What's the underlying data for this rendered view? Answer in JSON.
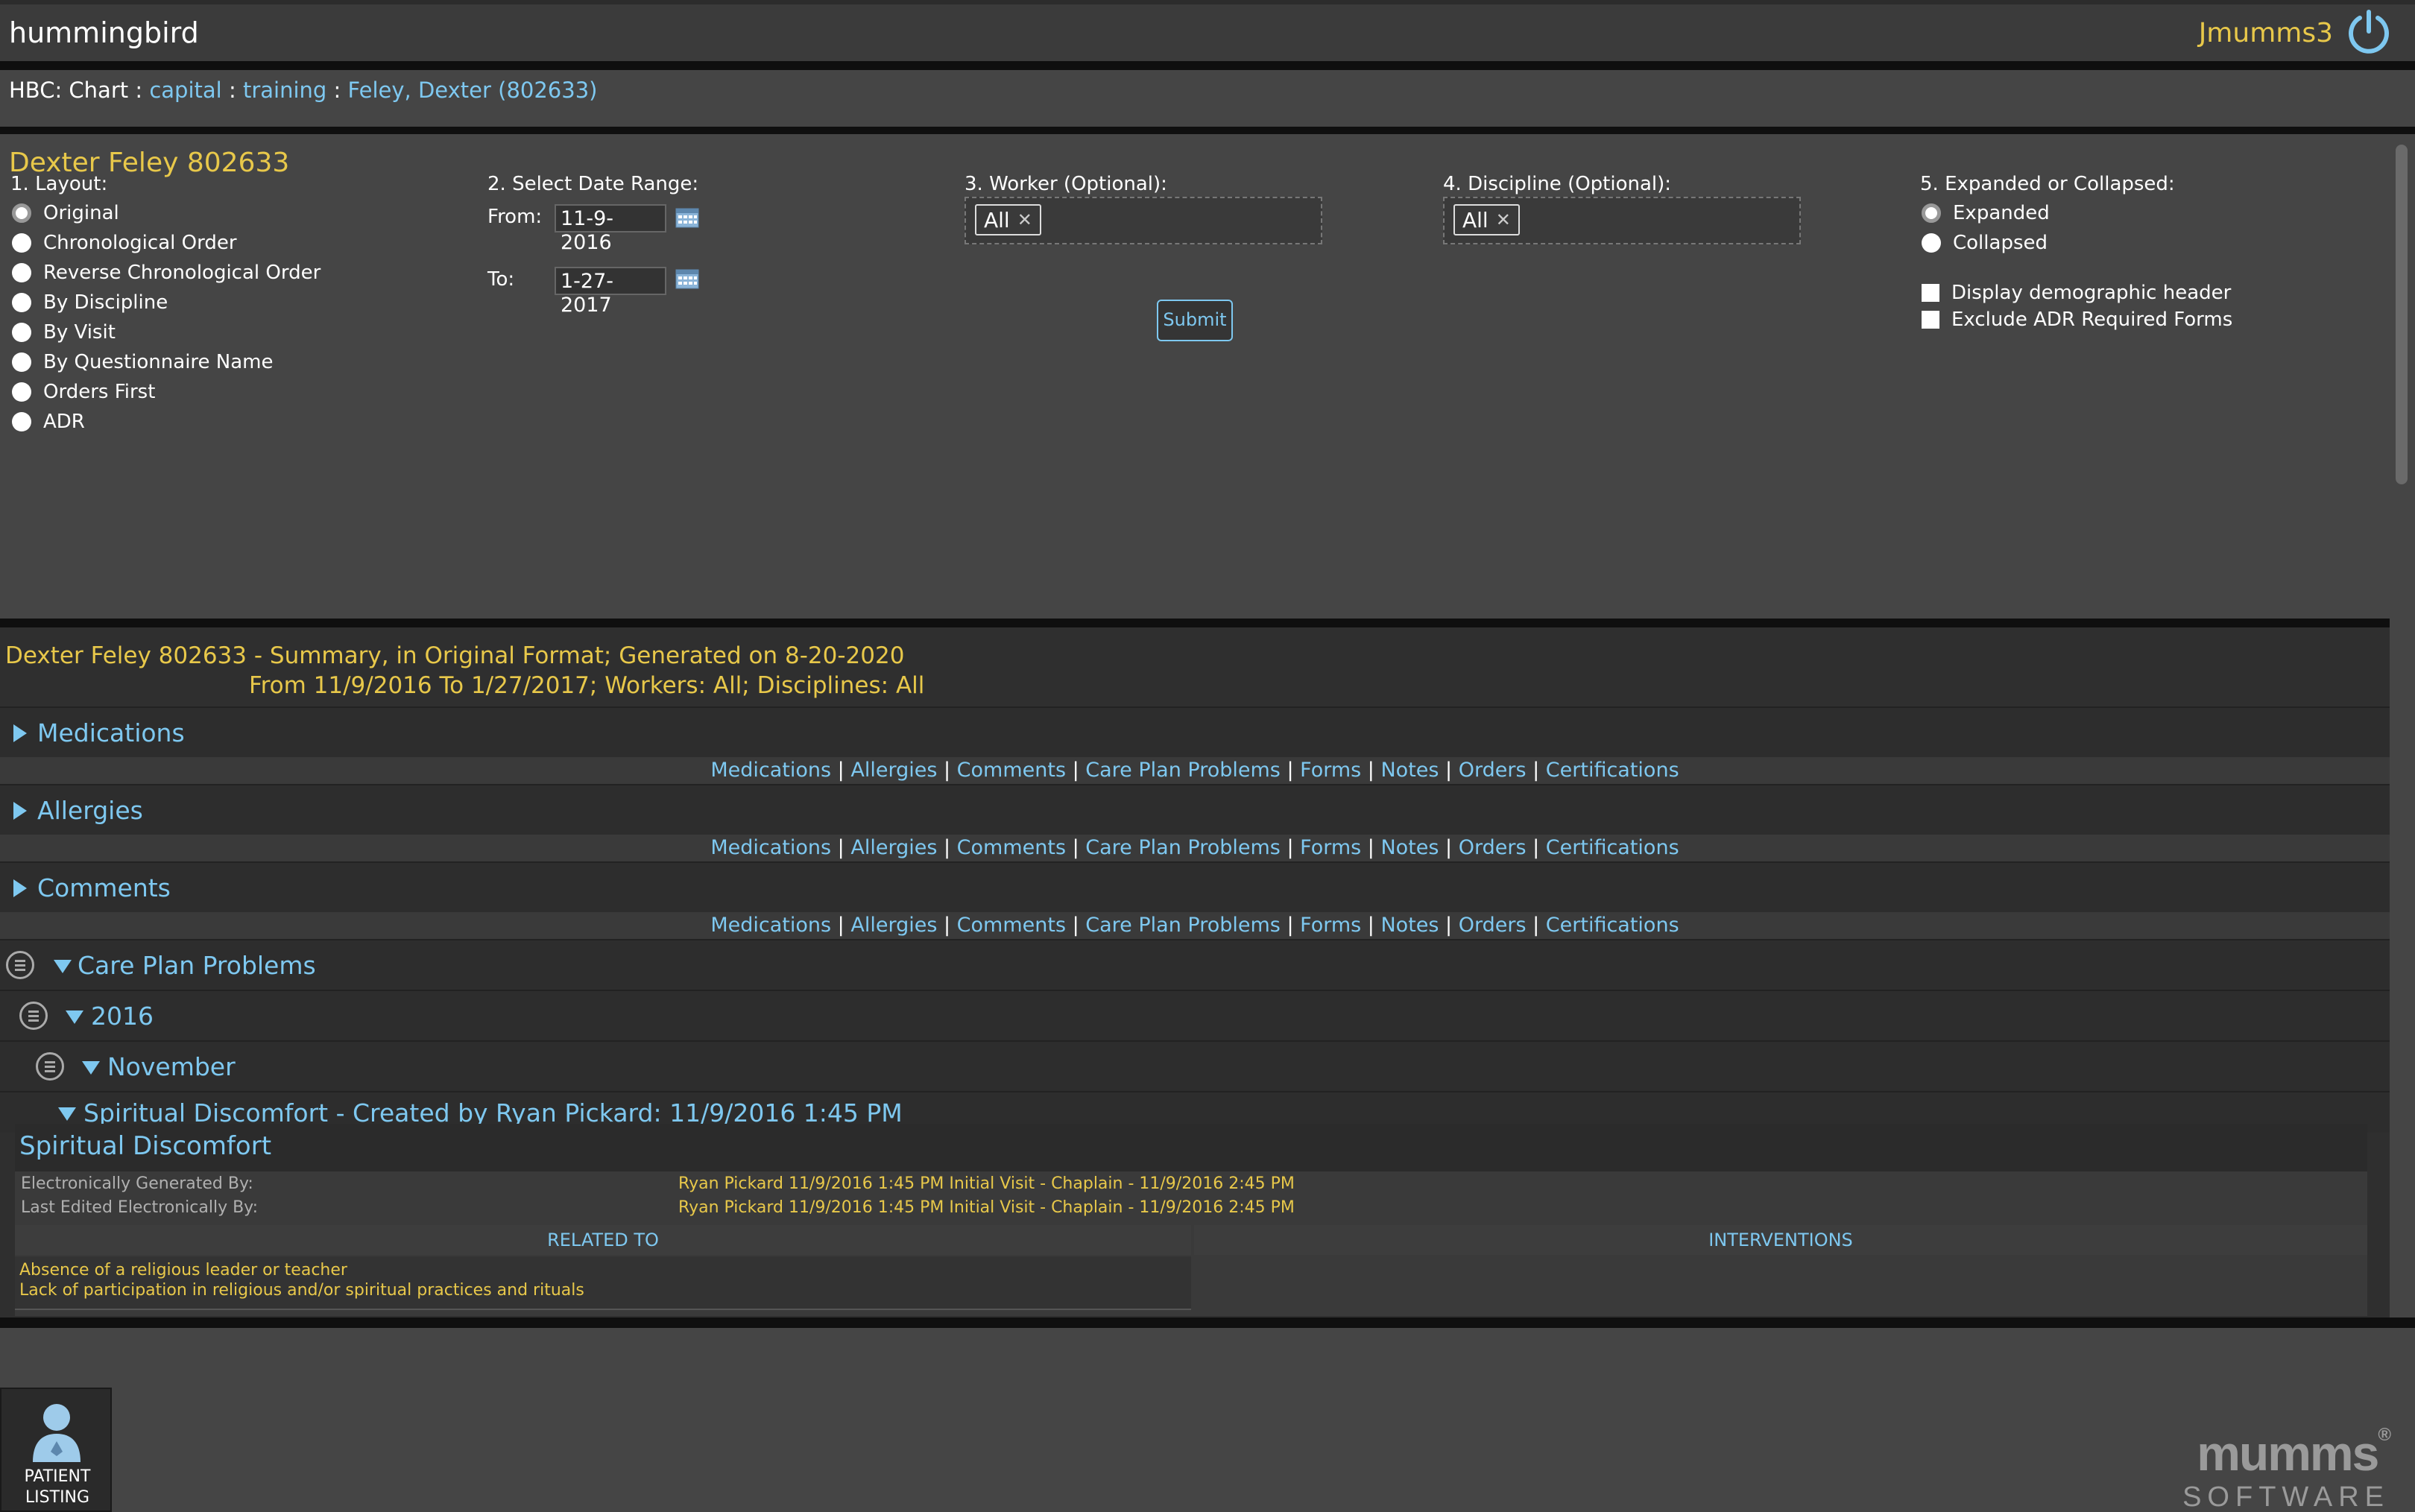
{
  "app": {
    "title": "hummingbird",
    "username": "Jmumms3"
  },
  "breadcrumb": {
    "prefix": "HBC: Chart :",
    "sep": ":",
    "link1": "capital",
    "link2": "training",
    "link3": "Feley, Dexter (802633)"
  },
  "patient": {
    "header": "Dexter Feley 802633"
  },
  "filters": {
    "layout_label": "1. Layout:",
    "layout_options": [
      "Original",
      "Chronological Order",
      "Reverse Chronological Order",
      "By Discipline",
      "By Visit",
      "By Questionnaire Name",
      "Orders First",
      "ADR"
    ],
    "date_label": "2. Select Date Range:",
    "from_label": "From:",
    "from_value": "11-9-2016",
    "to_label": "To:",
    "to_value": "1-27-2017",
    "worker_label": "3. Worker (Optional):",
    "worker_chip": "All",
    "discipline_label": "4. Discipline (Optional):",
    "discipline_chip": "All",
    "expand_label": "5. Expanded or Collapsed:",
    "expand_options": [
      "Expanded",
      "Collapsed"
    ],
    "check_demographic": "Display demographic header",
    "check_adr": "Exclude ADR Required Forms",
    "submit_label": "Submit"
  },
  "summary": {
    "line1": "Dexter Feley 802633 - Summary, in Original Format; Generated on 8-20-2020",
    "line2": "From 11/9/2016 To 1/27/2017; Workers: All; Disciplines: All",
    "sections": [
      "Medications",
      "Allergies",
      "Comments"
    ],
    "nav": [
      "Medications",
      "Allergies",
      "Comments",
      "Care Plan Problems",
      "Forms",
      "Notes",
      "Orders",
      "Certifications"
    ],
    "care_plan": "Care Plan Problems",
    "year": "2016",
    "month": "November",
    "problem_row": "Spiritual Discomfort - Created by Ryan Pickard: 11/9/2016 1:45 PM"
  },
  "detail": {
    "title": "Spiritual Discomfort",
    "gen_label": "Electronically Generated By:",
    "gen_value": "Ryan Pickard 11/9/2016 1:45 PM Initial Visit - Chaplain - 11/9/2016 2:45 PM",
    "edit_label": "Last Edited Electronically By:",
    "edit_value": "Ryan Pickard 11/9/2016 1:45 PM Initial Visit - Chaplain - 11/9/2016 2:45 PM",
    "col_related": "RELATED TO",
    "col_interventions": "INTERVENTIONS",
    "related_items": [
      "Absence of a religious leader or teacher",
      "Lack of participation in religious and/or spiritual practices and rituals"
    ]
  },
  "footer": {
    "patient_listing_line1": "PATIENT",
    "patient_listing_line2": "LISTING",
    "logo_main": "mumms",
    "logo_reg": "®",
    "logo_sub": "SOFTWARE"
  },
  "colors": {
    "accent_blue": "#7ec8f0",
    "accent_yellow": "#e8c84a",
    "bg": "#454545"
  }
}
